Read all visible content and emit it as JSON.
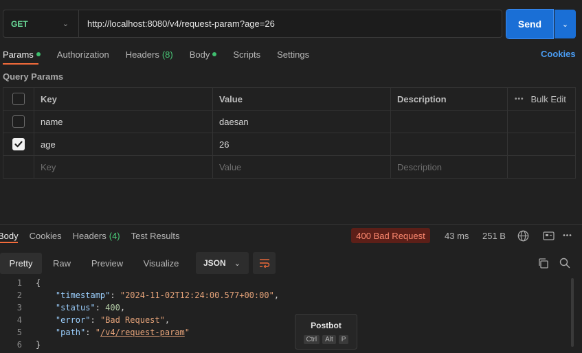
{
  "request": {
    "method": "GET",
    "url": "http://localhost:8080/v4/request-param?age=26",
    "send_label": "Send"
  },
  "request_tabs": [
    {
      "label": "Params",
      "dot": true
    },
    {
      "label": "Authorization"
    },
    {
      "label": "Headers",
      "count": "(8)"
    },
    {
      "label": "Body",
      "dot": true
    },
    {
      "label": "Scripts"
    },
    {
      "label": "Settings"
    }
  ],
  "cookies_link": "Cookies",
  "query_params": {
    "title": "Query Params",
    "headers": {
      "key": "Key",
      "value": "Value",
      "description": "Description",
      "bulk_edit": "Bulk Edit"
    },
    "rows": [
      {
        "checked": false,
        "key": "name",
        "value": "daesan",
        "description": ""
      },
      {
        "checked": true,
        "key": "age",
        "value": "26",
        "description": ""
      }
    ],
    "placeholder": {
      "key": "Key",
      "value": "Value",
      "description": "Description"
    }
  },
  "response_tabs": [
    {
      "label": "Body"
    },
    {
      "label": "Cookies"
    },
    {
      "label": "Headers",
      "count": "(4)"
    },
    {
      "label": "Test Results"
    }
  ],
  "response_meta": {
    "status": "400 Bad Request",
    "time": "43 ms",
    "size": "251 B"
  },
  "view_modes": [
    "Pretty",
    "Raw",
    "Preview",
    "Visualize"
  ],
  "format": "JSON",
  "postbot": {
    "title": "Postbot",
    "keys": [
      "Ctrl",
      "Alt",
      "P"
    ]
  },
  "colors": {
    "accent": "#f26b3a",
    "send": "#1a6fd6",
    "error_badge": "#5c1f18",
    "error_text": "#ff8a70",
    "get": "#6bdd9a"
  }
}
